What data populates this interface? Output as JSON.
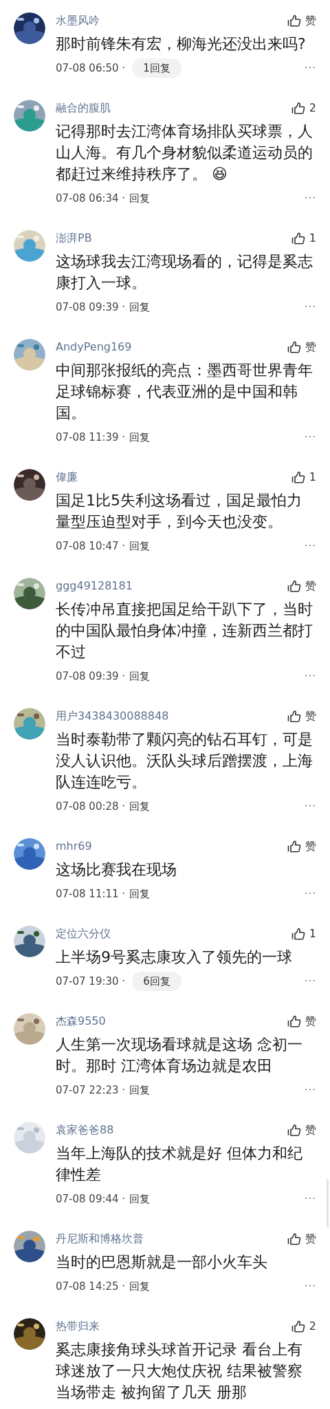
{
  "comments": [
    {
      "user": "水墨风吟",
      "likes": "赞",
      "text": "那时前锋朱有宏，柳海光还没出来吗?",
      "time": "07-08 06:50 ·",
      "reply": {
        "kind": "pill",
        "label": "1回复"
      },
      "more": "···"
    },
    {
      "user": "融合的腹肌",
      "likes": "2",
      "text": "记得那时去江湾体育场排队买球票，人山人海。有几个身材貌似柔道运动员的都赶过来维持秩序了。 😆",
      "time": "07-08 06:34 ·",
      "reply": {
        "kind": "link",
        "label": "回复"
      },
      "more": "···"
    },
    {
      "user": "澎湃PB",
      "likes": "1",
      "text": "这场球我去江湾现场看的，记得是奚志康打入一球。",
      "time": "07-08 09:39 ·",
      "reply": {
        "kind": "link",
        "label": "回复"
      },
      "more": "···"
    },
    {
      "user": "AndyPeng169",
      "likes": "赞",
      "text": "中间那张报纸的亮点：墨西哥世界青年足球锦标赛，代表亚洲的是中国和韩国。",
      "time": "07-08 11:39 ·",
      "reply": {
        "kind": "link",
        "label": "回复"
      },
      "more": "···"
    },
    {
      "user": "偉廉",
      "likes": "1",
      "text": "国足1比5失利这场看过，国足最怕力量型压迫型对手，到今天也没变。",
      "time": "07-08 10:47 ·",
      "reply": {
        "kind": "link",
        "label": "回复"
      },
      "more": "···"
    },
    {
      "user": "ggg49128181",
      "likes": "赞",
      "text": "长传冲吊直接把国足给干趴下了，当时的中国队最怕身体冲撞，连新西兰都打不过",
      "time": "07-08 09:39 ·",
      "reply": {
        "kind": "link",
        "label": "回复"
      },
      "more": "···"
    },
    {
      "user": "用户3438430088848",
      "likes": "赞",
      "text": "当时泰勒带了颗闪亮的钻石耳钉，可是没人认识他。沃队头球后蹭摆渡，上海队连连吃亏。",
      "time": "07-08 00:28 ·",
      "reply": {
        "kind": "link",
        "label": "回复"
      },
      "more": "···"
    },
    {
      "user": "mhr69",
      "likes": "赞",
      "text": "这场比赛我在现场",
      "time": "07-08 11:11 ·",
      "reply": {
        "kind": "link",
        "label": "回复"
      },
      "more": "···"
    },
    {
      "user": "定位六分仪",
      "likes": "1",
      "text": "上半场9号奚志康攻入了领先的一球",
      "time": "07-07 19:30 ·",
      "reply": {
        "kind": "pill",
        "label": "6回复"
      },
      "more": "···"
    },
    {
      "user": "杰森9550",
      "likes": "赞",
      "text": "人生第一次现场看球就是这场 念初一时。那时 江湾体育场边就是农田",
      "time": "07-07 22:23 ·",
      "reply": {
        "kind": "link",
        "label": "回复"
      },
      "more": "···"
    },
    {
      "user": "袁家爸爸88",
      "likes": "赞",
      "text": "当年上海队的技术就是好 但体力和纪律性差",
      "time": "07-08 09:44 ·",
      "reply": {
        "kind": "link",
        "label": "回复"
      },
      "more": "···"
    },
    {
      "user": "丹尼斯和博格坎普",
      "likes": "赞",
      "text": "当时的巴恩斯就是一部小火车头",
      "time": "07-08 14:25 ·",
      "reply": {
        "kind": "link",
        "label": "回复"
      },
      "more": "···"
    },
    {
      "user": "热带归来",
      "likes": "2",
      "text": "奚志康接角球头球首开记录 看台上有球迷放了一只大炮仗庆祝 结果被警察当场带走 被拘留了几天 册那"
    }
  ]
}
